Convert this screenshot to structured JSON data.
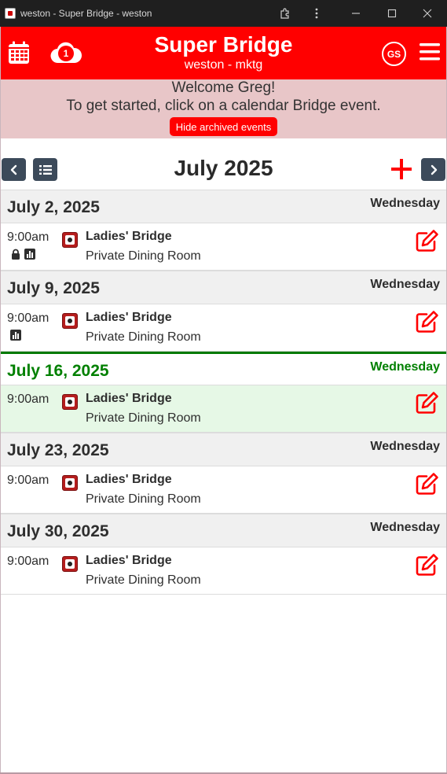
{
  "window": {
    "title": "weston - Super Bridge - weston",
    "icons": [
      "extension-icon",
      "more-vert-icon",
      "minimize-icon",
      "maximize-icon",
      "close-icon"
    ]
  },
  "header": {
    "title": "Super Bridge",
    "subtitle": "weston - mktg",
    "cloud_badge": "1",
    "avatar_initials": "GS",
    "brand_color": "#ff0000"
  },
  "welcome": {
    "line1": "Welcome Greg!",
    "line2": "To get started, click on a calendar Bridge event.",
    "hide_archived_label": "Hide archived events"
  },
  "month_nav": {
    "title": "July 2025"
  },
  "days": [
    {
      "date": "July 2, 2025",
      "weekday": "Wednesday",
      "today": false,
      "events": [
        {
          "time": "9:00am",
          "name": "Ladies' Bridge",
          "location": "Private Dining Room",
          "badges": [
            "lock-icon",
            "results-chart-icon"
          ]
        }
      ]
    },
    {
      "date": "July 9, 2025",
      "weekday": "Wednesday",
      "today": false,
      "events": [
        {
          "time": "9:00am",
          "name": "Ladies' Bridge",
          "location": "Private Dining Room",
          "badges": [
            "results-chart-icon"
          ]
        }
      ]
    },
    {
      "date": "July 16, 2025",
      "weekday": "Wednesday",
      "today": true,
      "events": [
        {
          "time": "9:00am",
          "name": "Ladies' Bridge",
          "location": "Private Dining Room",
          "badges": []
        }
      ]
    },
    {
      "date": "July 23, 2025",
      "weekday": "Wednesday",
      "today": false,
      "events": [
        {
          "time": "9:00am",
          "name": "Ladies' Bridge",
          "location": "Private Dining Room",
          "badges": []
        }
      ]
    },
    {
      "date": "July 30, 2025",
      "weekday": "Wednesday",
      "today": false,
      "events": [
        {
          "time": "9:00am",
          "name": "Ladies' Bridge",
          "location": "Private Dining Room",
          "badges": []
        }
      ]
    }
  ],
  "colors": {
    "today_green": "#008000",
    "today_row_bg": "#e6f8e6",
    "nav_button": "#3c4a5a",
    "welcome_bg": "#e8c6c8"
  }
}
